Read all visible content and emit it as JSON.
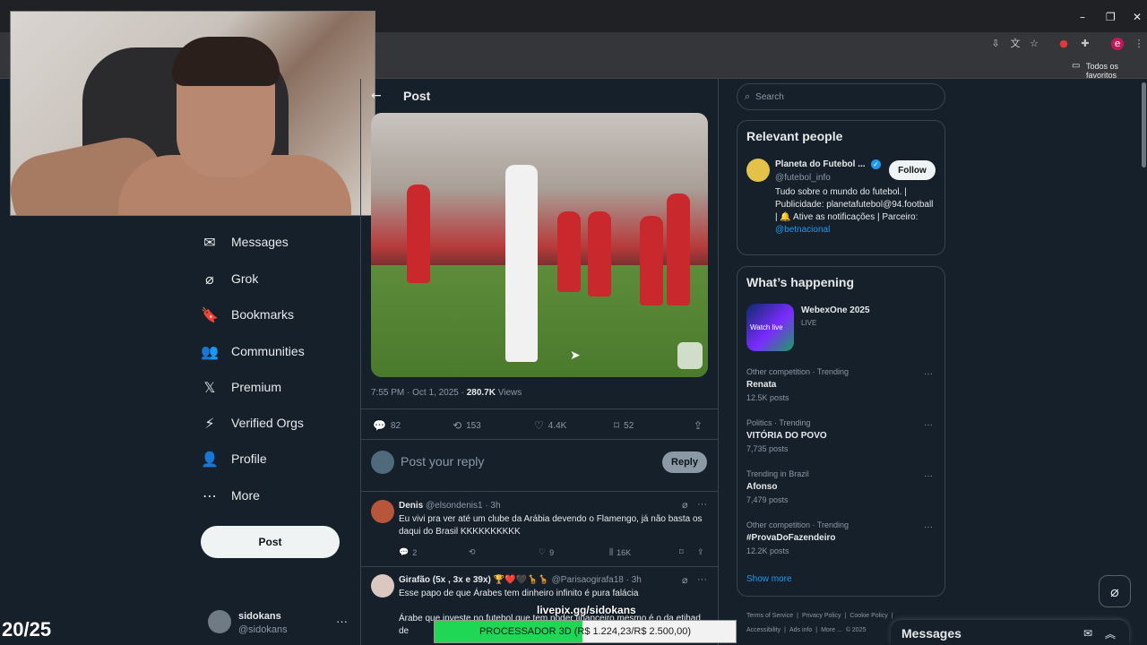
{
  "browser": {
    "bookmarks_folder": "Todos os favoritos",
    "minimize": "–",
    "restore": "❐",
    "close": "✕"
  },
  "nav": {
    "items": [
      {
        "label": "Messages",
        "icon": "✉"
      },
      {
        "label": "Grok",
        "icon": "⌀"
      },
      {
        "label": "Bookmarks",
        "icon": "🔖"
      },
      {
        "label": "Communities",
        "icon": "👥"
      },
      {
        "label": "Premium",
        "icon": "𝕏"
      },
      {
        "label": "Verified Orgs",
        "icon": "⚡"
      },
      {
        "label": "Profile",
        "icon": "👤"
      },
      {
        "label": "More",
        "icon": "⋯"
      }
    ],
    "post_button": "Post",
    "account": {
      "name": "sidokans",
      "handle": "@sidokans",
      "more": "···"
    }
  },
  "stream": {
    "counter": "20/25",
    "livepix": "livepix.gg/sidokans",
    "goal_text": "PROCESSADOR 3D (R$ 1.224,23/R$ 2.500,00)",
    "goal_fraction": 0.49
  },
  "main": {
    "title": "Post",
    "back_icon": "←",
    "meta_time": "7:55 PM · Oct 1, 2025 · ",
    "meta_views_count": "280.7K",
    "meta_views_label": " Views",
    "actions": {
      "replies": "82",
      "reposts": "153",
      "likes": "4.4K",
      "bookmarks": "52"
    },
    "reply_placeholder": "Post your reply",
    "reply_button": "Reply",
    "replies": [
      {
        "name": "Denis",
        "handle": "@elsondenis1 · 3h",
        "text": "Eu vivi pra ver até um clube da Arábia devendo o Flamengo, já não basta os daqui do Brasil KKKKKKKKKK",
        "replies": "2",
        "likes": "9",
        "views": "16K"
      },
      {
        "name": "Girafão (5x , 3x e 39x) 🏆❤️🖤🦒🦒",
        "handle": "@Parisaogirafa18 · 3h",
        "text": "Esse papo de que Árabes tem dinheiro infinito é pura falácia",
        "text2": "Árabe que investe no futebol que tem poder financeiro mesmo é o da etihad de"
      }
    ]
  },
  "right": {
    "search_placeholder": "Search",
    "relevant_title": "Relevant people",
    "person": {
      "name": "Planeta do Futebol ...",
      "handle": "@futebol_info",
      "follow": "Follow",
      "bio": "Tudo sobre o mundo do futebol. | Publicidade: planetafutebol@94.football | 🔔 Ative as notificações | Parceiro:",
      "bio_link": "@betnacional"
    },
    "happening_title": "What’s happening",
    "event": {
      "name": "WebexOne 2025",
      "status": "LIVE",
      "thumb_label": "Watch live"
    },
    "trends": [
      {
        "context": "Other competition · Trending",
        "name": "Renata",
        "count": "12.5K posts"
      },
      {
        "context": "Politics · Trending",
        "name": "VITÓRIA DO POVO",
        "count": "7,735 posts"
      },
      {
        "context": "Trending in Brazil",
        "name": "Afonso",
        "count": "7,479 posts"
      },
      {
        "context": "Other competition · Trending",
        "name": "#ProvaDoFazendeiro",
        "count": "12.2K posts"
      }
    ],
    "show_more": "Show more",
    "footer": [
      "Terms of Service",
      "|",
      "Privacy Policy",
      "|",
      "Cookie Policy",
      "|",
      "Accessibility",
      "|",
      "Ads info",
      "|",
      "More ...",
      "© 2025"
    ],
    "messages_title": "Messages"
  }
}
